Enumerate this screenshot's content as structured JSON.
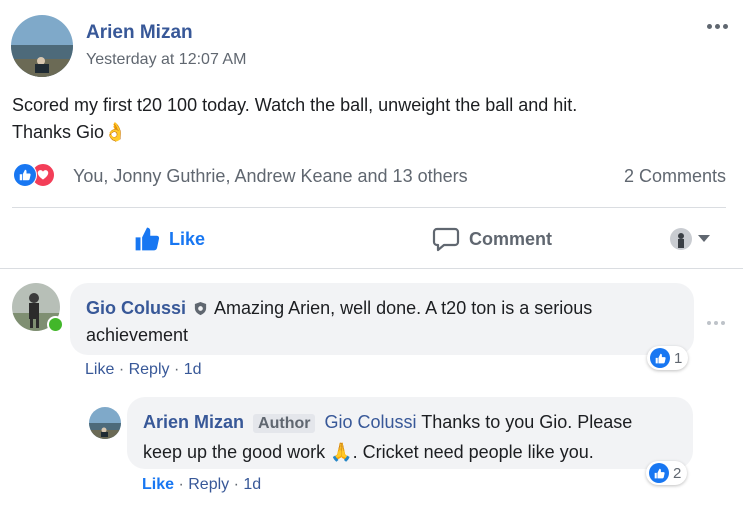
{
  "post": {
    "author": "Arien Mizan",
    "timestamp": "Yesterday at 12:07 AM",
    "text_line1": "Scored my first t20 100 today. Watch the ball, unweight the ball and hit.",
    "text_line2": "Thanks Gio",
    "text_emoji": "👌",
    "reactions_summary": "You, Jonny Guthrie, Andrew Keane and 13 others",
    "comments_count": "2 Comments"
  },
  "actions": {
    "like": "Like",
    "comment": "Comment"
  },
  "comments": [
    {
      "author": "Gio Colussi",
      "text_line1": "Amazing Arien, well done. A t20 ton is a serious",
      "text_line2": "achievement",
      "like": "Like",
      "reply": "Reply",
      "age": "1d",
      "reaction_count": "1"
    }
  ],
  "reply": {
    "author": "Arien Mizan",
    "badge": "Author",
    "mention": "Gio Colussi",
    "text_line1": "Thanks to you Gio. Please",
    "text_line2a": "keep up the good work",
    "emoji": "🙏",
    "text_line2b": ". Cricket need people like you.",
    "like": "Like",
    "reply": "Reply",
    "age": "1d",
    "reaction_count": "2"
  },
  "separator": "·",
  "colors": {
    "link": "#385898",
    "brand_blue": "#1877f2",
    "love_red": "#f33e58",
    "muted": "#606770",
    "bubble": "#f2f3f5",
    "online": "#42b72a"
  }
}
